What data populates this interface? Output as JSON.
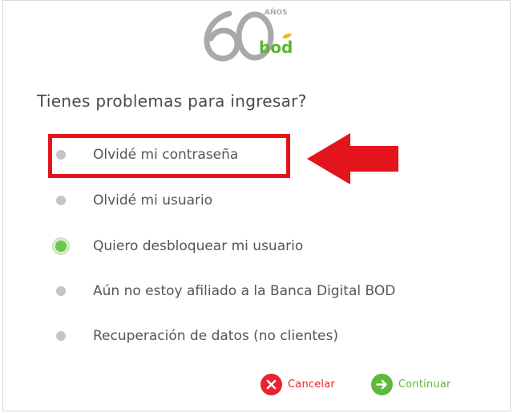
{
  "brand": {
    "logo_number": "60",
    "logo_years": "AÑOS",
    "logo_name": "bod",
    "colors": {
      "logo_gray": "#a7a9ac",
      "logo_green": "#5cb531",
      "logo_leaf": "#f2b705"
    }
  },
  "dialog": {
    "question": "Tienes problemas para ingresar?"
  },
  "options": [
    {
      "label": "Olvidé mi contraseña",
      "checked": false
    },
    {
      "label": "Olvidé mi usuario",
      "checked": false
    },
    {
      "label": "Quiero desbloquear mi usuario",
      "checked": true
    },
    {
      "label": "Aún no estoy afiliado a la Banca Digital BOD",
      "checked": false
    },
    {
      "label": "Recuperación de datos (no clientes)",
      "checked": false
    }
  ],
  "actions": {
    "cancel_label": "Cancelar",
    "cancel_icon": "close-x-icon",
    "continue_label": "Continuar",
    "continue_icon": "arrow-right-icon"
  },
  "annotation": {
    "highlight_color": "#e3141c",
    "arrow_color": "#e3141c"
  },
  "colors": {
    "accent_green": "#5dba3b",
    "danger_red": "#e8232f",
    "radio_unchecked": "#c4c4c4",
    "radio_checked": "#6cc84a"
  }
}
